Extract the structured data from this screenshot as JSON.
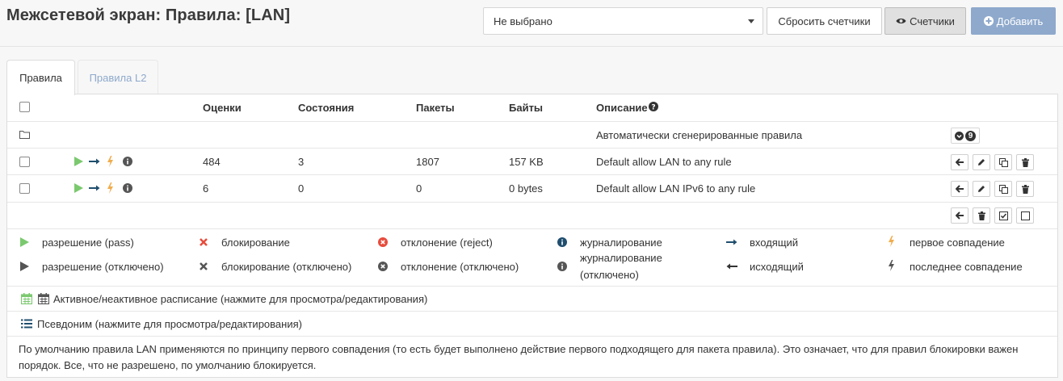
{
  "header": {
    "title": "Межсетевой экран: Правила: [LAN]",
    "select_value": "Не выбрано",
    "reset_label": "Сбросить счетчики",
    "counters_label": "Счетчики",
    "add_label": "Добавить"
  },
  "tabs": [
    {
      "label": "Правила"
    },
    {
      "label": "Правила L2"
    }
  ],
  "table": {
    "headers": {
      "ratings": "Оценки",
      "states": "Состояния",
      "packets": "Пакеты",
      "bytes": "Байты",
      "description": "Описание"
    },
    "auto_group": {
      "description": "Автоматически сгенерированные правила",
      "count": "9"
    },
    "rules": [
      {
        "ratings": "484",
        "states": "3",
        "packets": "1807",
        "bytes": "157 KB",
        "description": "Default allow LAN to any rule"
      },
      {
        "ratings": "6",
        "states": "0",
        "packets": "0",
        "bytes": "0 bytes",
        "description": "Default allow LAN IPv6 to any rule"
      }
    ]
  },
  "legend": {
    "pass": "разрешение (pass)",
    "block": "блокирование",
    "reject": "отклонение (reject)",
    "log": "журналирование",
    "in": "входящий",
    "first": "первое совпадение",
    "pass_disabled": "разрешение (отключено)",
    "block_disabled": "блокирование (отключено)",
    "reject_disabled": "отклонение (отключено)",
    "log_disabled_1": "журналирование",
    "log_disabled_2": "(отключено)",
    "out": "исходящий",
    "last": "последнее совпадение",
    "schedule": "Активное/неактивное расписание (нажмите для просмотра/редактирования)",
    "alias": "Псевдоним (нажмите для просмотра/редактирования)"
  },
  "notice": {
    "line1": "По умолчанию правила LAN применяются по принципу первого совпадения (то есть будет выполнено действие первого подходящего для пакета правила). Это означает, что для правил блокировки важен",
    "line2": "порядок. Все, что не разрешено, по умолчанию блокируется."
  },
  "colors": {
    "pass": "#7bc96f",
    "block": "#e74c3c",
    "arrow": "#1f4e6e",
    "first": "#f0ad4e",
    "add_button": "#8ea9cc",
    "info": "#555555"
  }
}
